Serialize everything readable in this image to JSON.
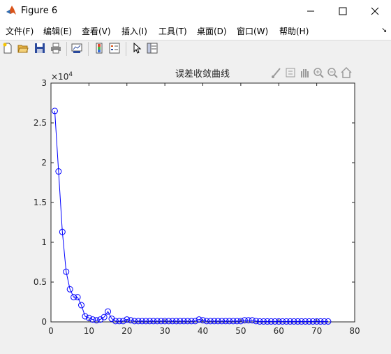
{
  "window": {
    "title": "Figure 6",
    "minimize": "—",
    "maximize": "☐",
    "close": "✕"
  },
  "menu": {
    "items": [
      "文件(F)",
      "编辑(E)",
      "查看(V)",
      "插入(I)",
      "工具(T)",
      "桌面(D)",
      "窗口(W)",
      "帮助(H)"
    ]
  },
  "toolbar": {
    "icons": [
      "new-figure-icon",
      "open-file-icon",
      "save-icon",
      "print-icon",
      "link-plot-icon",
      "insert-colorbar-icon",
      "insert-legend-icon",
      "edit-plot-icon",
      "property-editor-icon"
    ]
  },
  "axes_toolbar": {
    "icons": [
      "brush-icon",
      "data-tips-icon",
      "pan-icon",
      "zoom-in-icon",
      "zoom-out-icon",
      "home-icon"
    ]
  },
  "colors": {
    "line": "#0000ff",
    "marker": "#0000ff"
  },
  "chart_data": {
    "type": "line",
    "title": "误差收敛曲线",
    "xlabel": "",
    "ylabel": "",
    "xlim": [
      0,
      80
    ],
    "ylim": [
      0,
      30000
    ],
    "x_ticks": [
      "0",
      "10",
      "20",
      "30",
      "40",
      "50",
      "60",
      "70",
      "80"
    ],
    "y_ticks": [
      "0",
      "0.5",
      "1",
      "1.5",
      "2",
      "2.5",
      "3"
    ],
    "y_exponent_label": "×10",
    "y_exponent": "4",
    "marker": "circle",
    "series": [
      {
        "x": [
          1,
          2,
          3,
          4,
          5,
          6,
          7,
          8,
          9,
          10,
          11,
          12,
          13,
          14,
          15,
          16,
          17,
          18,
          19,
          20,
          21,
          22,
          23,
          24,
          25,
          26,
          27,
          28,
          29,
          30,
          31,
          32,
          33,
          34,
          35,
          36,
          37,
          38,
          39,
          40,
          41,
          42,
          43,
          44,
          45,
          46,
          47,
          48,
          49,
          50,
          51,
          52,
          53,
          54,
          55,
          56,
          57,
          58,
          59,
          60,
          61,
          62,
          63,
          64,
          65,
          66,
          67,
          68,
          69,
          70,
          71,
          72,
          73
        ],
        "values": [
          26500,
          18900,
          11300,
          6300,
          4100,
          3100,
          3100,
          2100,
          700,
          500,
          300,
          200,
          300,
          600,
          1300,
          400,
          100,
          100,
          100,
          300,
          200,
          100,
          100,
          100,
          100,
          100,
          100,
          100,
          100,
          100,
          100,
          100,
          100,
          100,
          100,
          100,
          100,
          100,
          300,
          200,
          100,
          100,
          100,
          100,
          100,
          100,
          100,
          100,
          100,
          100,
          200,
          200,
          200,
          100,
          50,
          50,
          50,
          50,
          50,
          50,
          50,
          50,
          50,
          50,
          50,
          50,
          50,
          50,
          50,
          50,
          50,
          50,
          50
        ]
      }
    ]
  }
}
